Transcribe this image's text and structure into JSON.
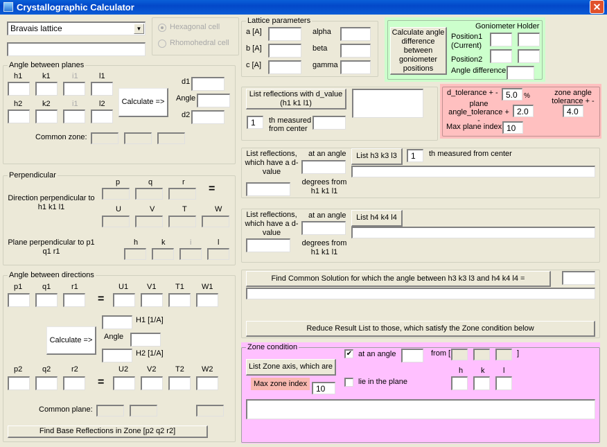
{
  "window": {
    "title": "Crystallographic Calculator",
    "close": "✕"
  },
  "top": {
    "bravais_value": "Bravais lattice",
    "second_value": "",
    "hexagonal": "Hexagonal cell",
    "rhombohedral": "Rhomohedral cell"
  },
  "lattice": {
    "legend": "Lattice parameters",
    "a": "a [A]",
    "b": "b [A]",
    "c": "c [A]",
    "alpha": "alpha",
    "beta": "beta",
    "gamma": "gamma"
  },
  "goniometer": {
    "button": "Calculate angle difference between goniometer positions",
    "col1": "Goniometer",
    "col2": "Holder",
    "pos1": "Position1 (Current)",
    "pos2": "Position2",
    "angle_diff": "Angle difference"
  },
  "planes": {
    "legend": "Angle between planes",
    "h1": "h1",
    "k1": "k1",
    "i1": "i1",
    "l1": "l1",
    "h2": "h2",
    "k2": "k2",
    "i2": "i1",
    "l2": "l2",
    "calculate": "Calculate =>",
    "d1": "d1",
    "angle": "Angle",
    "d2": "d2",
    "common_zone": "Common zone:"
  },
  "dvalue": {
    "button": "List reflections with d_value (h1 k1 l1)",
    "nth": "1",
    "measured": "th measured from center"
  },
  "tolerance": {
    "d_tol_label": "d_tolerance  + -",
    "d_tol": "5.0",
    "percent": "%",
    "plane_angle_label": "plane angle_tolerance  + -",
    "plane_angle": "2.0",
    "zone_angle_label": "zone angle tolerance  + -",
    "zone_angle": "4.0",
    "max_plane_label": "Max plane index",
    "max_plane": "10"
  },
  "perpendicular": {
    "legend": "Perpendicular",
    "direction_label": "Direction perpendicular to h1 k1 l1",
    "p": "p",
    "q": "q",
    "r": "r",
    "U": "U",
    "V": "V",
    "T": "T",
    "W": "W",
    "plane_label": "Plane perpendicular to p1 q1 r1",
    "h": "h",
    "k": "k",
    "i": "i",
    "l": "l"
  },
  "list3": {
    "label": "List reflections, which have a d-value",
    "at_angle": "at an angle",
    "degrees": "degrees from h1 k1 l1",
    "button": "List h3 k3 l3",
    "nth": "1",
    "measured": "th measured from center"
  },
  "list4": {
    "label": "List reflections, which have a d-value",
    "at_angle": "at an angle",
    "degrees": "degrees from h1 k1 l1",
    "button": "List h4 k4 l4"
  },
  "directions": {
    "legend": "Angle between directions",
    "p1": "p1",
    "q1": "q1",
    "r1": "r1",
    "U1": "U1",
    "V1": "V1",
    "T1": "T1",
    "W1": "W1",
    "H1": "H1   [1/A]",
    "angle": "Angle",
    "H2": "H2   [1/A]",
    "calculate": "Calculate =>",
    "p2": "p2",
    "q2": "q2",
    "r2": "r2",
    "U2": "U2",
    "V2": "V2",
    "T2": "T2",
    "W2": "W2",
    "common_plane": "Common plane:",
    "find_base": "Find Base Reflections in Zone [p2 q2 r2]"
  },
  "common": {
    "find_button": "Find Common Solution for which  the angle between h3 k3 l3  and  h4 k4 l4 =",
    "reduce_button": "Reduce Result List to those, which satisfy the Zone condition below"
  },
  "zone": {
    "legend": "Zone condition",
    "list_button": "List Zone axis, which are",
    "max_zone_label": "Max zone index",
    "max_zone": "10",
    "at_angle": "at an angle",
    "at_angle_checked": true,
    "from_open": "from [",
    "from_close": "]",
    "lie_plane": "lie in the plane",
    "lie_plane_checked": false,
    "h": "h",
    "k": "k",
    "l": "l",
    "check_mark": "✔"
  }
}
